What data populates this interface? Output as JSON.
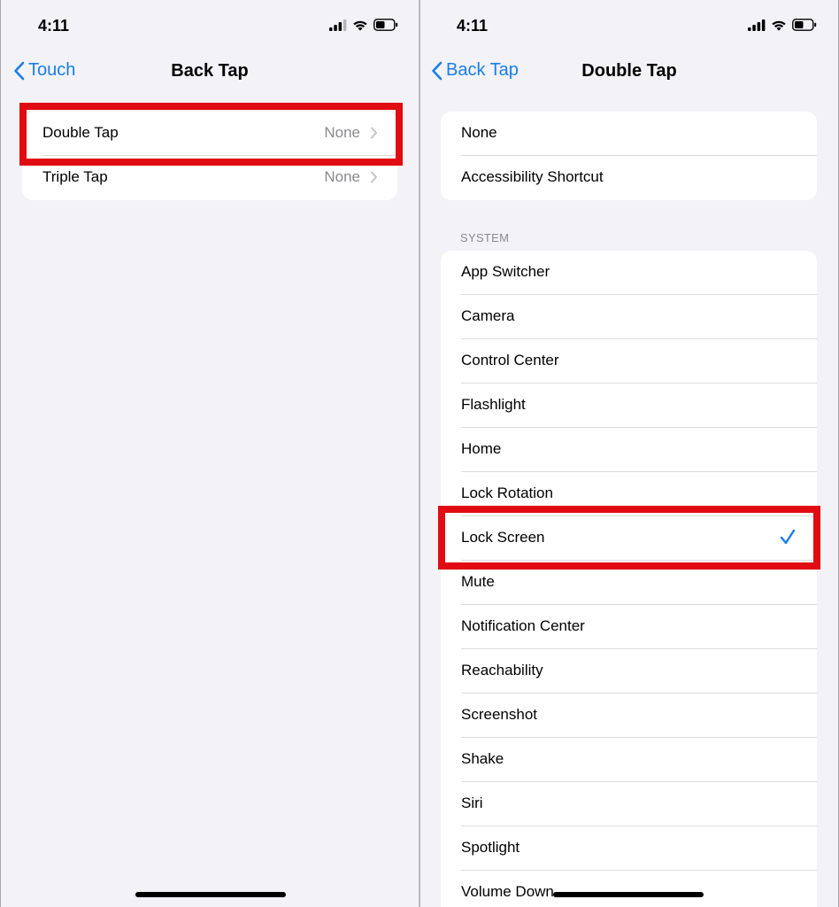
{
  "left": {
    "status_time": "4:11",
    "back_label": "Touch",
    "title": "Back Tap",
    "rows": [
      {
        "label": "Double Tap",
        "value": "None"
      },
      {
        "label": "Triple Tap",
        "value": "None"
      }
    ]
  },
  "right": {
    "status_time": "4:11",
    "back_label": "Back Tap",
    "title": "Double Tap",
    "top_rows": [
      {
        "label": "None"
      },
      {
        "label": "Accessibility Shortcut"
      }
    ],
    "section_header": "SYSTEM",
    "system_rows": [
      {
        "label": "App Switcher"
      },
      {
        "label": "Camera"
      },
      {
        "label": "Control Center"
      },
      {
        "label": "Flashlight"
      },
      {
        "label": "Home"
      },
      {
        "label": "Lock Rotation"
      },
      {
        "label": "Lock Screen",
        "selected": true
      },
      {
        "label": "Mute"
      },
      {
        "label": "Notification Center"
      },
      {
        "label": "Reachability"
      },
      {
        "label": "Screenshot"
      },
      {
        "label": "Shake"
      },
      {
        "label": "Siri"
      },
      {
        "label": "Spotlight"
      },
      {
        "label": "Volume Down"
      }
    ]
  },
  "icons": {
    "back": "chevron-left-icon",
    "disclosure": "chevron-right-icon",
    "selected": "checkmark-icon",
    "signal": "cellular-signal-icon",
    "wifi": "wifi-icon",
    "battery": "battery-icon"
  },
  "colors": {
    "accent": "#1a7dea",
    "highlight": "#e10b12",
    "background": "#f2f2f7",
    "secondary_text": "#8a8a8e"
  }
}
